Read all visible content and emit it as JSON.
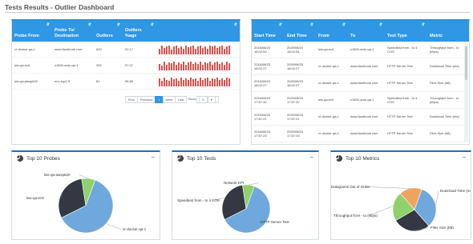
{
  "page": {
    "title": "Tests Results - Outlier Dashboard"
  },
  "outliers": {
    "columns": [
      "Probe From",
      "Probe To/ Destination",
      "Outliers",
      "Outliers %age",
      ""
    ],
    "rows": [
      {
        "from": "vr-docker-qa-1",
        "to": "www.facebook.com",
        "outliers": "620",
        "pct": "92.17",
        "spark": [
          0.6,
          0.9,
          0.7,
          0.8,
          0.95,
          0.5,
          0.85,
          0.9,
          0.7,
          0.8,
          0.6,
          0.9,
          0.75,
          0.85,
          0.95,
          0.6,
          0.8,
          0.9,
          0.7,
          0.85,
          0.6,
          0.9,
          0.8,
          0.95,
          0.7,
          0.85,
          0.9,
          0.6,
          0.8,
          0.9
        ]
      },
      {
        "from": "lws-qa-ec9",
        "to": "x1600-auto-qa-1",
        "outliers": "292",
        "pct": "97.07",
        "spark": [
          0.7,
          0.5,
          0.9,
          0.6,
          0.8,
          0.75,
          0.95,
          0.55,
          0.85,
          0.7,
          0.9,
          0.6,
          0.8,
          0.95,
          0.65,
          0.85,
          0.7,
          0.9,
          0.6,
          0.8,
          0.75,
          0.9,
          0.55,
          0.85,
          0.95,
          0.7,
          0.8,
          0.6,
          0.9,
          0.75
        ]
      },
      {
        "from": "lws-qa-awsp620",
        "to": "nno-tcp2-9",
        "outliers": "81",
        "pct": "96.85",
        "spark": [
          0.8,
          0.6,
          0.9,
          0.7,
          0.55,
          0.95,
          0.75,
          0.85,
          0.6,
          0.9,
          0.7,
          0.8,
          0.65,
          0.95,
          0.75,
          0.85,
          0.6,
          0.9,
          0.7,
          0.8,
          0.95,
          0.6,
          0.85,
          0.75,
          0.9,
          0.65,
          0.8,
          0.7,
          0.95,
          0.85
        ]
      }
    ],
    "pager": {
      "first": "First",
      "previous": "Previous",
      "current": "1",
      "next": "Next",
      "last": "Last",
      "show": "Show",
      "show_value": "5"
    }
  },
  "tests": {
    "columns": [
      "Start Time",
      "End Time",
      "From",
      "To",
      "Test Type",
      "Metric"
    ],
    "rows": [
      {
        "start": "2016/08/23 18:02:54",
        "end": "2020/08/23 18:02:54",
        "from": "lws-qa-ec9",
        "to": "x1600-auto-qa-1",
        "type": "Speedtest from - to 4 COS",
        "metric": "Throughput from - to (kbps)"
      },
      {
        "start": "2016/08/23 18:02:27",
        "end": "2020/08/23 18:02:27",
        "from": "vr-docker-qa-1",
        "to": "www.facebook.com",
        "type": "HTTP Server Test",
        "metric": "Download Time (ms)"
      },
      {
        "start": "2016/08/23 18:02:27",
        "end": "2020/08/23 18:02:27",
        "from": "vr-docker-qa-1",
        "to": "www.facebook.com",
        "type": "HTTP Server Test",
        "metric": "Files Size (kB)"
      },
      {
        "start": "2016/08/23 17:57:32",
        "end": "2020/08/23 17:57:32",
        "from": "lws-qa-ec9",
        "to": "x1600-auto-qa-1",
        "type": "Speedtest from - to 4 COS",
        "metric": "Throughput from - to (kbps)"
      },
      {
        "start": "2016/08/23 17:57:21",
        "end": "2020/08/23 17:57:21",
        "from": "vr-docker-qa-1",
        "to": "www.facebook.com",
        "type": "HTTP Server Test",
        "metric": "Download Time (ms)"
      },
      {
        "start": "2016/08/23 17:57:23",
        "end": "2020/08/23 17:57:23",
        "from": "vr-docker-qa-1",
        "to": "www.facebook.com",
        "type": "HTTP Server Test",
        "metric": "Files Size (kB)"
      }
    ]
  },
  "charts": {
    "probes": {
      "title": "Top 10 Probes"
    },
    "tests": {
      "title": "Top 10 Tests"
    },
    "metrics": {
      "title": "Top 10 Metrics"
    },
    "collapse": "−"
  },
  "colors": {
    "header": "#2f97e4",
    "spark": "#d9534f",
    "pie_blue": "#6fa8dc",
    "pie_dark": "#333842",
    "pie_green": "#8fd16b",
    "pie_orange": "#f0a35c"
  },
  "chart_data": [
    {
      "type": "pie",
      "title": "Top 10 Probes",
      "slices": [
        {
          "label": "vr-docker-qa-1",
          "value": 62,
          "color": "#6fa8dc"
        },
        {
          "label": "lws-qa-ec9",
          "value": 30,
          "color": "#333842"
        },
        {
          "label": "lws-qa-awsp620",
          "value": 8,
          "color": "#8fd16b"
        }
      ]
    },
    {
      "type": "pie",
      "title": "Top 10 Tests",
      "slices": [
        {
          "label": "HTTP Server Test",
          "value": 62,
          "color": "#6fa8dc"
        },
        {
          "label": "Speedtest from - to 4 COS",
          "value": 30,
          "color": "#333842"
        },
        {
          "label": "Network KPI",
          "value": 8,
          "color": "#8fd16b"
        }
      ]
    },
    {
      "type": "pie",
      "title": "Top 10 Metrics",
      "slices": [
        {
          "label": "Download Time (ms)",
          "value": 33,
          "color": "#6fa8dc"
        },
        {
          "label": "Files Size (kB)",
          "value": 28,
          "color": "#333842"
        },
        {
          "label": "Throughput from - to (kbps)",
          "value": 22,
          "color": "#8fd16b"
        },
        {
          "label": "Datagrams Out of Order",
          "value": 17,
          "color": "#f0a35c"
        }
      ]
    }
  ]
}
